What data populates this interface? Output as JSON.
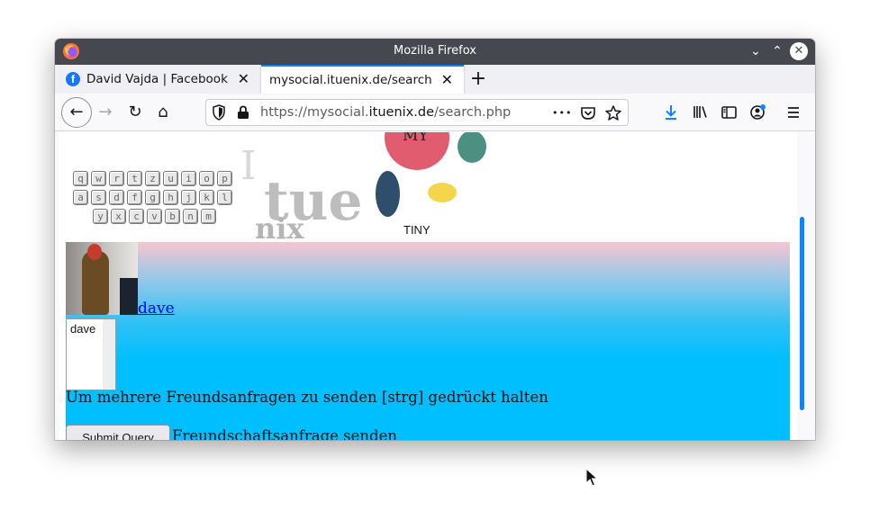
{
  "window": {
    "title": "Mozilla Firefox",
    "minimize": "⌄",
    "maximize": "⌃",
    "close": "✕"
  },
  "tabs": [
    {
      "label": "David Vajda | Facebook",
      "close": "✕",
      "icon": "facebook-icon",
      "active": false
    },
    {
      "label": "mysocial.ituenix.de/search.php",
      "close": "✕",
      "active": true
    }
  ],
  "new_tab": "+",
  "navbar": {
    "back": "←",
    "forward": "→",
    "reload": "↻",
    "home": "⌂",
    "url_prefix": "https://mysocial.",
    "url_host": "ituenix.de",
    "url_path": "/search.php",
    "page_actions": "•••",
    "icons": [
      "shield-icon",
      "lock-icon",
      "pocket-icon",
      "bookmark-star-icon",
      "download-icon",
      "library-icon",
      "sidebar-icon",
      "account-icon",
      "menu-icon"
    ]
  },
  "page": {
    "keyboard_rows": [
      [
        "q",
        "w",
        "r",
        "t",
        "z",
        "u",
        "i",
        "o",
        "p"
      ],
      [
        "a",
        "s",
        "d",
        "f",
        "g",
        "h",
        "j",
        "k",
        "l"
      ],
      [
        "y",
        "x",
        "c",
        "v",
        "b",
        "n",
        "m"
      ]
    ],
    "logo": {
      "i": "I",
      "tue": "tue",
      "nix": "nix"
    },
    "bubble_label": "MY",
    "tiny_label": "TINY",
    "user_link": "dave",
    "select_option": "dave",
    "hint": "Um mehrere Freundsanfragen zu senden [strg] gedrückt halten",
    "submit": "Submit Query",
    "send_label": "Freundschaftsanfrage senden"
  },
  "colors": {
    "accent": "#0a84ff",
    "titlebar": "#45494f",
    "content_bg": "#00bfff"
  }
}
